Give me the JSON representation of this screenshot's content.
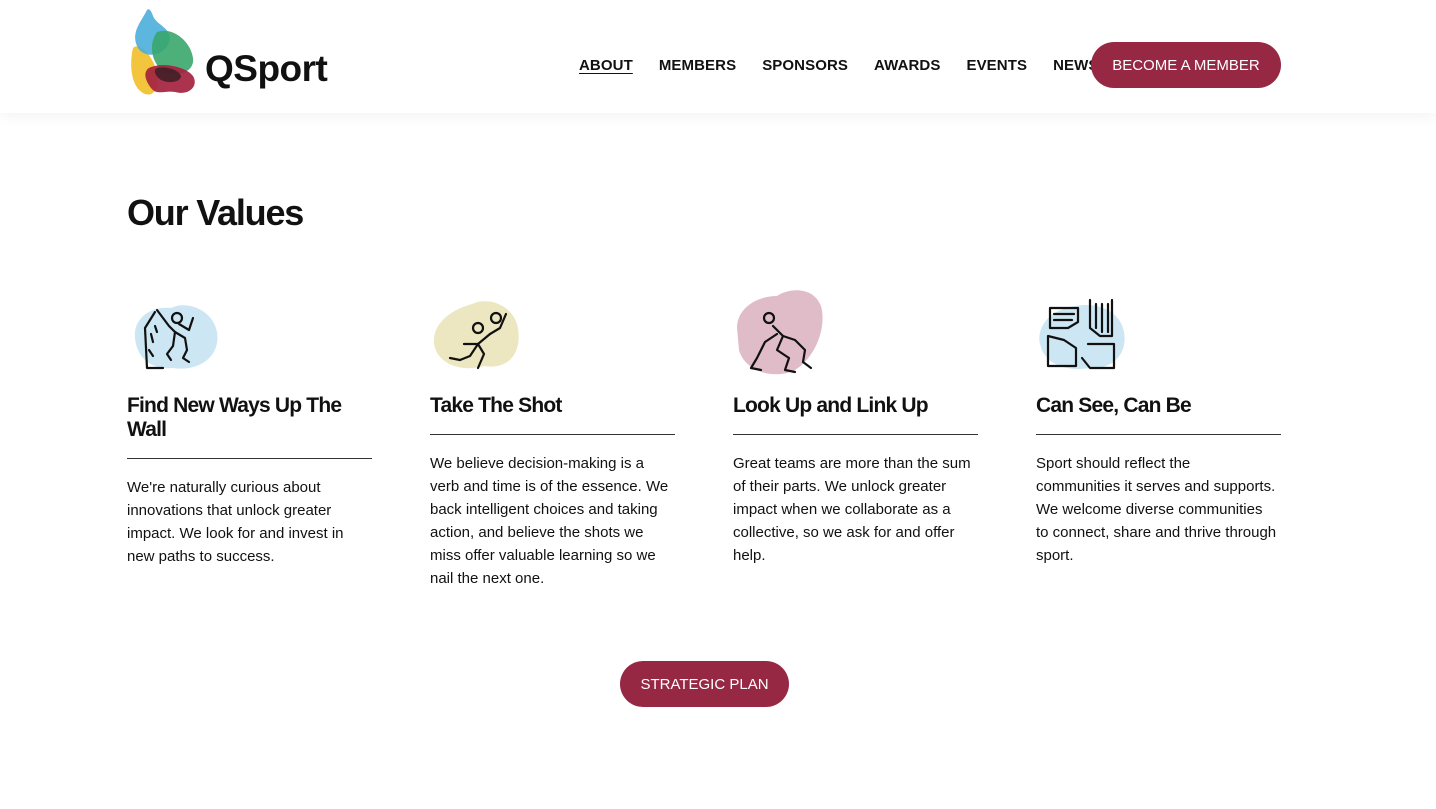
{
  "brand": {
    "name": "QSport"
  },
  "nav": {
    "items": [
      {
        "label": "ABOUT",
        "active": true
      },
      {
        "label": "MEMBERS",
        "active": false
      },
      {
        "label": "SPONSORS",
        "active": false
      },
      {
        "label": "AWARDS",
        "active": false
      },
      {
        "label": "EVENTS",
        "active": false
      },
      {
        "label": "NEWS",
        "active": false
      }
    ],
    "cta_label": "BECOME A MEMBER"
  },
  "colors": {
    "accent": "#962844",
    "blue_blob": "#cde6f3",
    "yellow_blob": "#ece7c0",
    "pink_blob": "#dfbcc7"
  },
  "section": {
    "title": "Our Values"
  },
  "values": [
    {
      "icon": "climber-icon",
      "title": "Find New Ways Up The Wall",
      "body": "We're naturally curious about innovations that unlock greater impact. We look for and invest in new paths to success."
    },
    {
      "icon": "volleyball-player-icon",
      "title": "Take The Shot",
      "body": "We believe decision-making is a verb and time is of the essence. We back intelligent choices and taking action, and believe the shots we miss offer valuable learning so we nail the next one."
    },
    {
      "icon": "hockey-player-icon",
      "title": "Look Up and Link Up",
      "body": "Great teams are more than the sum of their parts. We unlock greater impact when we collaborate as a collective, so we ask for and offer help."
    },
    {
      "icon": "linked-hands-icon",
      "title": "Can See, Can Be",
      "body": "Sport should reflect the communities it serves and supports. We welcome diverse communities to connect, share and thrive through sport."
    }
  ],
  "strategic_plan_label": "STRATEGIC PLAN"
}
